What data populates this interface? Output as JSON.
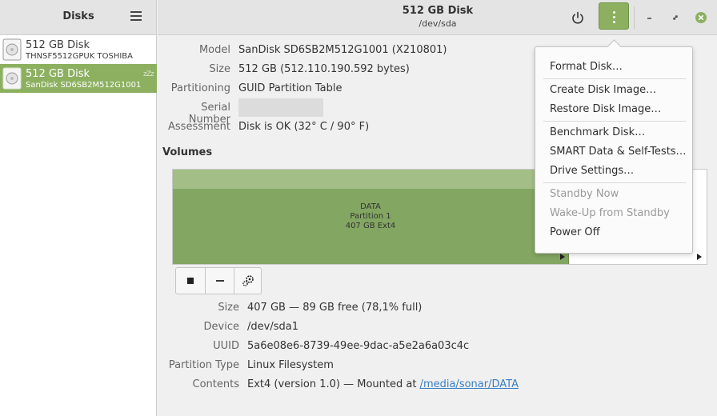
{
  "sidebar": {
    "title": "Disks",
    "disks": [
      {
        "name": "512 GB Disk",
        "model": "THNSF5512GPUK TOSHIBA"
      },
      {
        "name": "512 GB Disk",
        "model": "SanDisk SD6SB2M512G1001"
      }
    ],
    "standby_glyph": "zZz"
  },
  "header": {
    "title": "512 GB Disk",
    "subtitle": "/dev/sda"
  },
  "disk_info": {
    "labels": {
      "model": "Model",
      "size": "Size",
      "partitioning": "Partitioning",
      "serial": "Serial Number",
      "assessment": "Assessment"
    },
    "values": {
      "model": "SanDisk SD6SB2M512G1001 (X210801)",
      "size": "512 GB (512.110.190.592 bytes)",
      "partitioning": "GUID Partition Table",
      "assessment": "Disk is OK (32° C / 90° F)"
    }
  },
  "volumes": {
    "title": "Volumes",
    "partition": {
      "line1": "DATA",
      "line2": "Partition 1",
      "line3": "407 GB Ext4"
    }
  },
  "partition_info": {
    "labels": {
      "size": "Size",
      "device": "Device",
      "uuid": "UUID",
      "type": "Partition Type",
      "contents": "Contents"
    },
    "values": {
      "size": "407 GB — 89 GB free (78,1% full)",
      "device": "/dev/sda1",
      "uuid": "5a6e08e6-8739-49ee-9dac-a5e2a6a03c4c",
      "type": "Linux Filesystem",
      "contents_prefix": "Ext4 (version 1.0) — Mounted at ",
      "mount_link": "/media/sonar/DATA"
    }
  },
  "menu": {
    "format": "Format Disk…",
    "create_image": "Create Disk Image…",
    "restore_image": "Restore Disk Image…",
    "benchmark": "Benchmark Disk…",
    "smart": "SMART Data & Self-Tests…",
    "settings": "Drive Settings…",
    "standby": "Standby Now",
    "wakeup": "Wake-Up from Standby",
    "power_off": "Power Off"
  },
  "colors": {
    "accent": "#8cb060",
    "partition": "#83a662",
    "link": "#3b80c4"
  },
  "icons": [
    "hamburger-menu-icon",
    "power-icon",
    "kebab-menu-icon",
    "minimize-icon",
    "restore-icon",
    "close-icon",
    "hard-disk-icon",
    "stop-icon",
    "minus-icon",
    "gears-icon"
  ]
}
